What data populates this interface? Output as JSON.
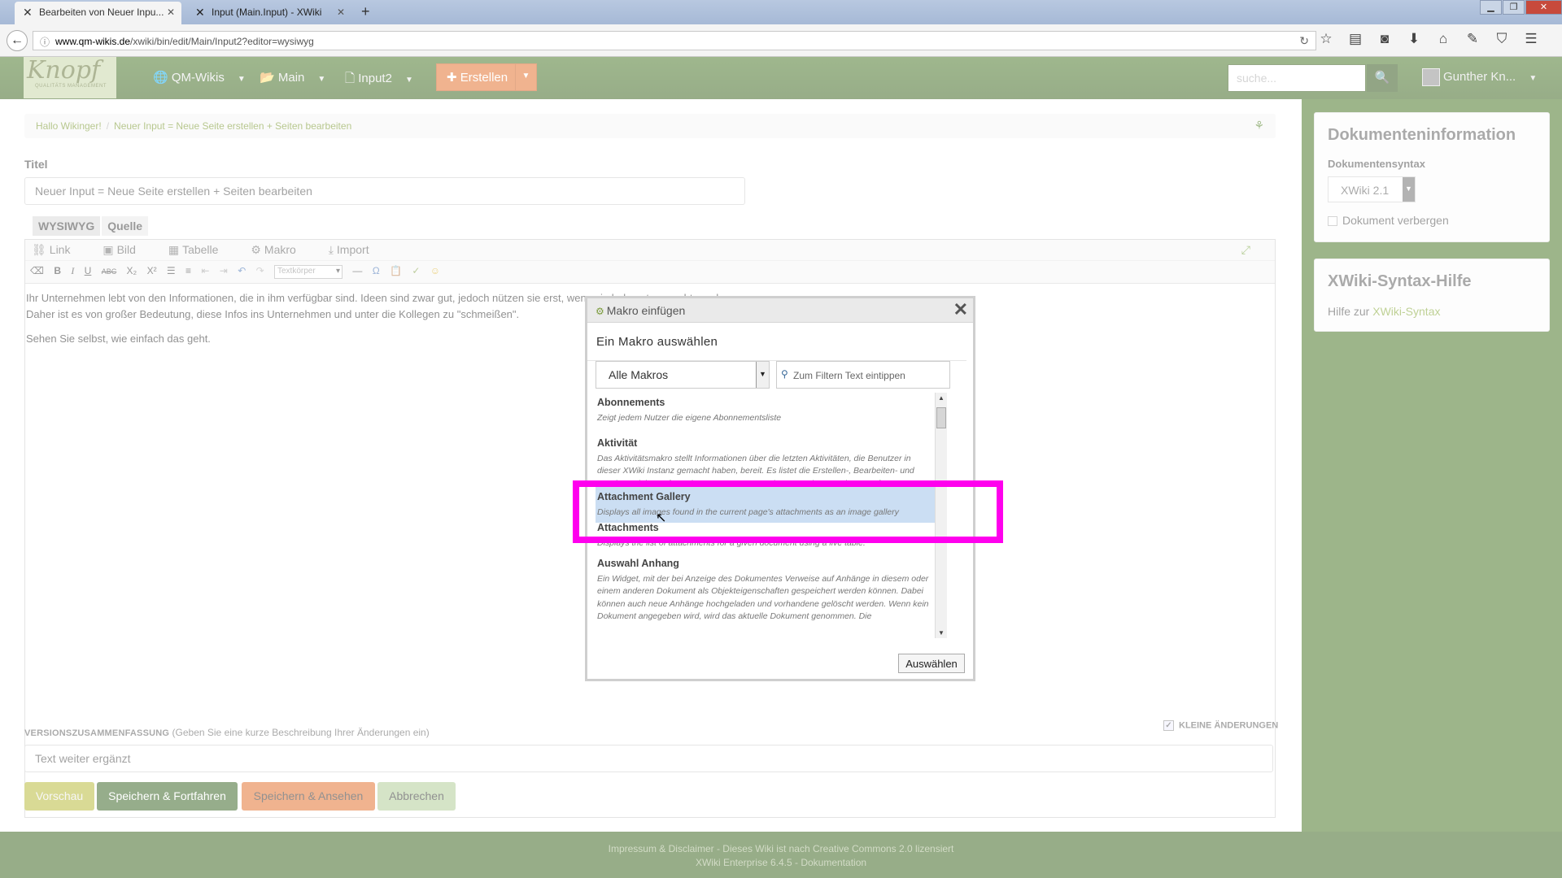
{
  "browser": {
    "tabs": [
      {
        "label": "Bearbeiten von Neuer Inpu...",
        "active": true
      },
      {
        "label": "Input (Main.Input) - XWiki",
        "active": false
      }
    ],
    "url_host": "www.qm-wikis.de",
    "url_path": "/xwiki/bin/edit/Main/Input2?editor=wysiwyg"
  },
  "header": {
    "logo_text": "Knopf",
    "logo_sub": "QUALITÄTS MANAGEMENT",
    "menu": [
      "QM-Wikis",
      "Main",
      "Input2"
    ],
    "create_label": "Erstellen",
    "search_placeholder": "suche...",
    "user_name": "Gunther Kn..."
  },
  "breadcrumb": [
    "Hallo Wikinger!",
    "Neuer Input = Neue Seite erstellen + Seiten bearbeiten"
  ],
  "form": {
    "title_label": "Titel",
    "title_value": "Neuer Input = Neue Seite erstellen + Seiten bearbeiten",
    "tabs": [
      "WYSIWYG",
      "Quelle"
    ],
    "toolbar1": [
      "Link",
      "Bild",
      "Tabelle",
      "Makro",
      "Import"
    ],
    "style_select": "Textkörper",
    "content": [
      "Ihr Unternehmen lebt von den Informationen, die in ihm verfügbar sind. Ideen sind zwar gut, jedoch nützen sie erst, wenn sie bekannt gemacht werden.",
      "Daher ist es von großer Bedeutung, diese Infos ins Unternehmen und unter die Kollegen zu \"schmeißen\".",
      "Sehen Sie selbst, wie einfach das geht."
    ],
    "version_label": "VERSIONSZUSAMMENFASSUNG",
    "version_hint": "(Geben Sie eine kurze Beschreibung Ihrer Änderungen ein)",
    "minor_label": "KLEINE ÄNDERUNGEN",
    "version_value": "Text weiter ergänzt",
    "buttons": {
      "preview": "Vorschau",
      "save_continue": "Speichern & Fortfahren",
      "save_view": "Speichern & Ansehen",
      "cancel": "Abbrechen"
    }
  },
  "sidebar": {
    "doc_info_title": "Dokumenteninformation",
    "syntax_label": "Dokumentensyntax",
    "syntax_value": "XWiki 2.1",
    "hide_doc_label": "Dokument verbergen",
    "help_title": "XWiki-Syntax-Hilfe",
    "help_text": "Hilfe zur",
    "help_link": "XWiki-Syntax"
  },
  "footer": {
    "line1": "Impressum & Disclaimer - Dieses Wiki ist nach Creative Commons 2.0 lizensiert",
    "line2": "XWiki Enterprise 6.4.5 - Dokumentation"
  },
  "modal": {
    "title": "Makro einfügen",
    "subtitle": "Ein Makro auswählen",
    "filter_select": "Alle Makros",
    "filter_placeholder": "Zum Filtern Text eintippen",
    "select_button": "Auswählen",
    "macros": [
      {
        "name": "Abonnements",
        "desc": "Zeigt jedem Nutzer die eigene Abonnementsliste",
        "selected": false
      },
      {
        "name": "Aktivität",
        "desc": "Das Aktivitätsmakro stellt Informationen über die letzten Aktivitäten, die Benutzer in dieser XWiki Instanz gemacht haben, bereit. Es listet die Erstellen-, Bearbeiten- und Löschen-Aktionen für Seiten, Kommentare, Anhänge und Annotationen auf.",
        "selected": false
      },
      {
        "name": "Attachment Gallery",
        "desc": "Displays all images found in the current page's attachments as an image gallery",
        "selected": true
      },
      {
        "name": "Attachments",
        "desc": "Displays the list of attachments for a given document using a live table.",
        "selected": false
      },
      {
        "name": "Auswahl Anhang",
        "desc": "Ein Widget, mit der bei Anzeige des Dokumentes Verweise auf Anhänge in diesem oder einem anderen Dokument als Objekteigenschaften gespeichert werden können. Dabei können auch neue Anhänge hochgeladen und vorhandene gelöscht werden. Wenn kein Dokument angegeben wird, wird das aktuelle Dokument genommen. Die",
        "selected": false
      }
    ]
  },
  "colors": {
    "header_green": "#2f5a10",
    "accent_orange": "#e0661f",
    "highlight_magenta": "#ff00ee"
  }
}
